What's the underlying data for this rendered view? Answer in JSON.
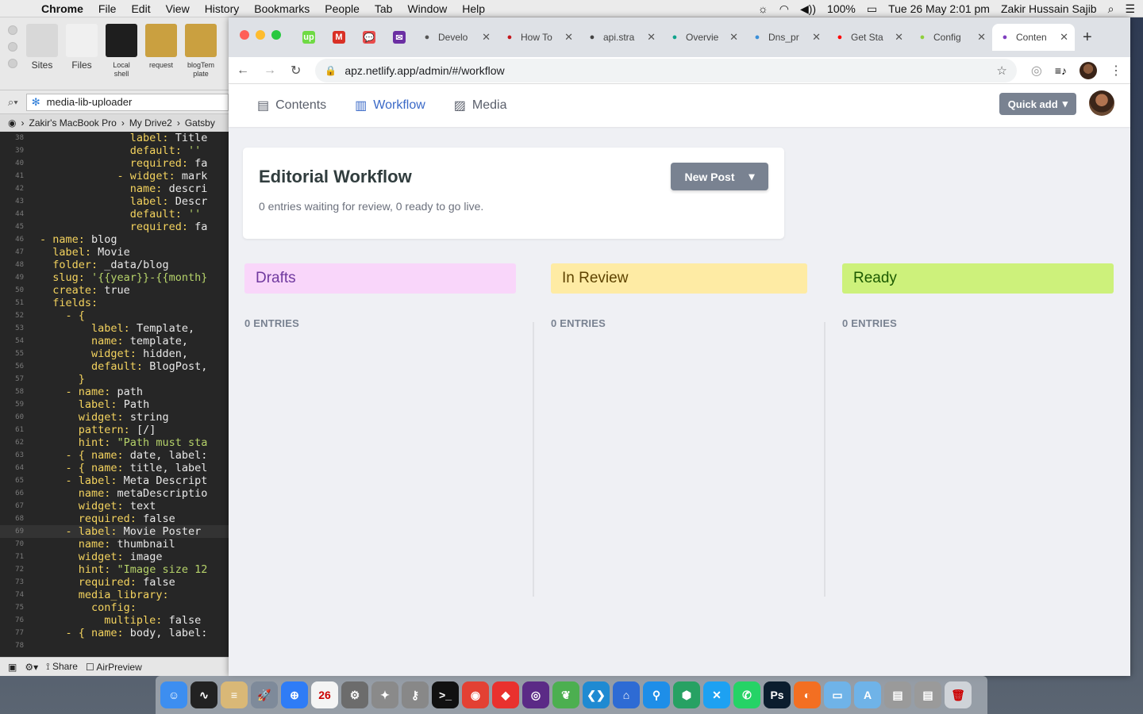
{
  "menubar": {
    "app": "Chrome",
    "items": [
      "File",
      "Edit",
      "View",
      "History",
      "Bookmarks",
      "People",
      "Tab",
      "Window",
      "Help"
    ],
    "battery": "100%",
    "datetime": "Tue 26 May  2:01 pm",
    "user": "Zakir Hussain Sajib"
  },
  "editor": {
    "toolbar_items": [
      {
        "label": "Sites",
        "color": "#d8d8d8"
      },
      {
        "label": "Files",
        "color": "#f0f0f0"
      },
      {
        "label": "Local shell",
        "color": "#1e1e1e"
      },
      {
        "label": "request",
        "color": "#caa040"
      },
      {
        "label": "blogTem plate",
        "color": "#caa040"
      }
    ],
    "search_value": "media-lib-uploader",
    "breadcrumbs": [
      "Zakir's MacBook Pro",
      "My Drive2",
      "Gatsby"
    ],
    "lines": [
      {
        "n": "38",
        "i": "              ",
        "k": "label:",
        "v": " Title"
      },
      {
        "n": "39",
        "i": "              ",
        "k": "default:",
        "v": " ''"
      },
      {
        "n": "40",
        "i": "              ",
        "k": "required:",
        "v": " fa"
      },
      {
        "n": "41",
        "i": "            ",
        "k": "- widget:",
        "v": " mark"
      },
      {
        "n": "42",
        "i": "              ",
        "k": "name:",
        "v": " descri"
      },
      {
        "n": "43",
        "i": "              ",
        "k": "label:",
        "v": " Descr"
      },
      {
        "n": "44",
        "i": "              ",
        "k": "default:",
        "v": " ''"
      },
      {
        "n": "45",
        "i": "              ",
        "k": "required:",
        "v": " fa"
      },
      {
        "n": "46",
        "i": "",
        "k": "- name:",
        "v": " blog"
      },
      {
        "n": "47",
        "i": "  ",
        "k": "label:",
        "v": " Movie"
      },
      {
        "n": "48",
        "i": "  ",
        "k": "folder:",
        "v": " _data/blog"
      },
      {
        "n": "49",
        "i": "  ",
        "k": "slug:",
        "v": " '{{year}}-{{month}"
      },
      {
        "n": "50",
        "i": "  ",
        "k": "create:",
        "v": " true"
      },
      {
        "n": "51",
        "i": "  ",
        "k": "fields:",
        "v": ""
      },
      {
        "n": "52",
        "i": "    ",
        "k": "- {",
        "v": ""
      },
      {
        "n": "53",
        "i": "        ",
        "k": "label:",
        "v": " Template,"
      },
      {
        "n": "54",
        "i": "        ",
        "k": "name:",
        "v": " template,"
      },
      {
        "n": "55",
        "i": "        ",
        "k": "widget:",
        "v": " hidden,"
      },
      {
        "n": "56",
        "i": "        ",
        "k": "default:",
        "v": " BlogPost,"
      },
      {
        "n": "57",
        "i": "      ",
        "k": "}",
        "v": ""
      },
      {
        "n": "58",
        "i": "    ",
        "k": "- name:",
        "v": " path"
      },
      {
        "n": "59",
        "i": "      ",
        "k": "label:",
        "v": " Path"
      },
      {
        "n": "60",
        "i": "      ",
        "k": "widget:",
        "v": " string"
      },
      {
        "n": "61",
        "i": "      ",
        "k": "pattern:",
        "v": " [/]"
      },
      {
        "n": "62",
        "i": "      ",
        "k": "hint:",
        "v": " \"Path must sta"
      },
      {
        "n": "63",
        "i": "    ",
        "k": "- { name:",
        "v": " date, label:"
      },
      {
        "n": "64",
        "i": "    ",
        "k": "- { name:",
        "v": " title, label"
      },
      {
        "n": "65",
        "i": "    ",
        "k": "- label:",
        "v": " Meta Descript"
      },
      {
        "n": "66",
        "i": "      ",
        "k": "name:",
        "v": " metaDescriptio"
      },
      {
        "n": "67",
        "i": "      ",
        "k": "widget:",
        "v": " text"
      },
      {
        "n": "68",
        "i": "      ",
        "k": "required:",
        "v": " false"
      },
      {
        "n": "69",
        "i": "    ",
        "k": "- label:",
        "v": " Movie Poster"
      },
      {
        "n": "70",
        "i": "      ",
        "k": "name:",
        "v": " thumbnail"
      },
      {
        "n": "71",
        "i": "      ",
        "k": "widget:",
        "v": " image"
      },
      {
        "n": "72",
        "i": "      ",
        "k": "hint:",
        "v": " \"Image size 12"
      },
      {
        "n": "73",
        "i": "      ",
        "k": "required:",
        "v": " false"
      },
      {
        "n": "74",
        "i": "      ",
        "k": "media_library:",
        "v": ""
      },
      {
        "n": "75",
        "i": "        ",
        "k": "config:",
        "v": ""
      },
      {
        "n": "76",
        "i": "          ",
        "k": "multiple:",
        "v": " false"
      },
      {
        "n": "77",
        "i": "    ",
        "k": "- { name:",
        "v": " body, label:"
      },
      {
        "n": "78",
        "i": "",
        "k": "",
        "v": ""
      }
    ],
    "status_share": "Share",
    "status_airpreview": "AirPreview"
  },
  "browser": {
    "tabs": [
      {
        "type": "pinned",
        "icon": "up",
        "color": "#6fda44"
      },
      {
        "type": "pinned",
        "icon": "M",
        "color": "#d93025"
      },
      {
        "type": "pinned",
        "icon": "💬",
        "color": "#e94c4c"
      },
      {
        "type": "pinned",
        "icon": "✉",
        "color": "#6b2fa3"
      },
      {
        "type": "normal",
        "title": "Develo",
        "color": "#555"
      },
      {
        "type": "normal",
        "title": "How To",
        "color": "#c4161c"
      },
      {
        "type": "normal",
        "title": "api.stra",
        "color": "#444"
      },
      {
        "type": "normal",
        "title": "Overvie",
        "color": "#10a38c"
      },
      {
        "type": "normal",
        "title": "Dns_pr",
        "color": "#3a8fd8"
      },
      {
        "type": "normal",
        "title": "Get Sta",
        "color": "#ff0000"
      },
      {
        "type": "normal",
        "title": "Config",
        "color": "#8fcf3c"
      },
      {
        "type": "active",
        "title": "Conten",
        "color": "#7f3fbf"
      }
    ],
    "url": "apz.netlify.app/admin/#/workflow"
  },
  "cms": {
    "nav": [
      {
        "label": "Contents",
        "icon": "document-icon",
        "active": false
      },
      {
        "label": "Workflow",
        "icon": "workflow-icon",
        "active": true
      },
      {
        "label": "Media",
        "icon": "image-icon",
        "active": false
      }
    ],
    "quick_add": "Quick add",
    "workflow": {
      "title": "Editorial Workflow",
      "subtitle": "0 entries waiting for review, 0 ready to go live.",
      "new_post": "New Post"
    },
    "columns": [
      {
        "title": "Drafts",
        "bg": "#f9d6fa",
        "fg": "#70399f",
        "count": "0 ENTRIES"
      },
      {
        "title": "In Review",
        "bg": "#feeba4",
        "fg": "#5e4300",
        "count": "0 ENTRIES"
      },
      {
        "title": "Ready",
        "bg": "#cdf17b",
        "fg": "#1c5a00",
        "count": "0 ENTRIES"
      }
    ]
  },
  "dock": {
    "apps": [
      {
        "name": "finder-icon",
        "color": "#3d8ef0",
        "glyph": "☺"
      },
      {
        "name": "activity-monitor-icon",
        "color": "#222",
        "glyph": "∿"
      },
      {
        "name": "notes-icon",
        "color": "#d9b877",
        "glyph": "≡"
      },
      {
        "name": "launchpad-icon",
        "color": "#7e8a9a",
        "glyph": "🚀"
      },
      {
        "name": "safari-icon",
        "color": "#2f7cf6",
        "glyph": "⊕"
      },
      {
        "name": "calendar-icon",
        "color": "#f4f4f4",
        "glyph": "26"
      },
      {
        "name": "system-preferences-icon",
        "color": "#6c6c6c",
        "glyph": "⚙"
      },
      {
        "name": "utility-icon",
        "color": "#8a8a8a",
        "glyph": "✦"
      },
      {
        "name": "keychain-icon",
        "color": "#888",
        "glyph": "⚷"
      },
      {
        "name": "terminal-icon",
        "color": "#111",
        "glyph": ">_"
      },
      {
        "name": "chrome-icon",
        "color": "#e34133",
        "glyph": "◉"
      },
      {
        "name": "anydesk-icon",
        "color": "#e9312e",
        "glyph": "◆"
      },
      {
        "name": "podcasts-icon",
        "color": "#5b2a86",
        "glyph": "◎"
      },
      {
        "name": "sourcetree-icon",
        "color": "#4caf50",
        "glyph": "❦"
      },
      {
        "name": "vscode-icon",
        "color": "#1f8ad2",
        "glyph": "❮❯"
      },
      {
        "name": "network-icon",
        "color": "#2e6bd4",
        "glyph": "⌂"
      },
      {
        "name": "maps-icon",
        "color": "#1e8ee8",
        "glyph": "⚲"
      },
      {
        "name": "sublime-icon",
        "color": "#27a163",
        "glyph": "⬢"
      },
      {
        "name": "xcode-icon",
        "color": "#1da1f2",
        "glyph": "✕"
      },
      {
        "name": "whatsapp-icon",
        "color": "#25d366",
        "glyph": "✆"
      },
      {
        "name": "photoshop-icon",
        "color": "#0b1d2e",
        "glyph": "Ps"
      },
      {
        "name": "firefox-icon",
        "color": "#f36f22",
        "glyph": "◐"
      },
      {
        "name": "folder-icon",
        "color": "#6fb3e8",
        "glyph": "▭"
      },
      {
        "name": "applications-folder-icon",
        "color": "#6fb3e8",
        "glyph": "A"
      },
      {
        "name": "drive-icon",
        "color": "#9a9a9a",
        "glyph": "▤"
      },
      {
        "name": "drive2-icon",
        "color": "#9a9a9a",
        "glyph": "▤"
      },
      {
        "name": "trash-icon",
        "color": "#cfd3d8",
        "glyph": "🗑"
      }
    ]
  }
}
